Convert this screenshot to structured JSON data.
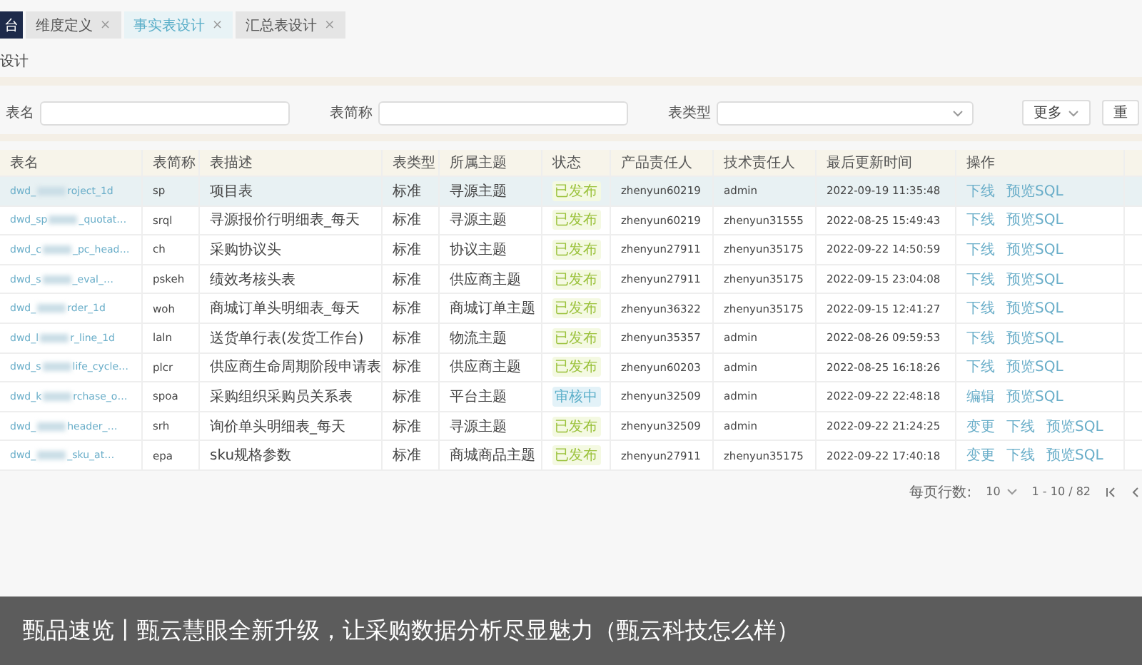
{
  "tabs": [
    {
      "label": "台",
      "selected": false,
      "kind": "home"
    },
    {
      "label": "维度定义",
      "close": "×",
      "selected": false,
      "kind": "page"
    },
    {
      "label": "事实表设计",
      "close": "×",
      "selected": true,
      "kind": "page"
    },
    {
      "label": "汇总表设计",
      "close": "×",
      "selected": false,
      "kind": "page"
    }
  ],
  "page_title": "设计",
  "filters": [
    {
      "label": "表名",
      "kind": "input"
    },
    {
      "label": "表简称",
      "kind": "input"
    },
    {
      "label": "表类型",
      "kind": "select"
    }
  ],
  "buttons": [
    {
      "label": "更多",
      "kind": "dropdown"
    },
    {
      "label": "重",
      "kind": "plain"
    }
  ],
  "table": {
    "columns": [
      "表名",
      "表简称",
      "表描述",
      "表类型",
      "所属主题",
      "状态",
      "产品责任人",
      "技术责任人",
      "最后更新时间",
      "操作"
    ],
    "rows": [
      {
        "name_start": "dwd_",
        "name_end": "roject_1d",
        "short": "sp",
        "desc": "项目表",
        "type": "标准",
        "theme": "寻源主题",
        "status": {
          "label": "已发布",
          "kind": "published"
        },
        "owner": "zhenyun60219",
        "tech": "admin",
        "updated": "2022-09-19 11:35:48",
        "actions": [
          "下线",
          "预览SQL"
        ],
        "selected": true
      },
      {
        "name_start": "dwd_sp",
        "name_end": "_quotat…",
        "short": "srql",
        "desc": "寻源报价行明细表_每天",
        "type": "标准",
        "theme": "寻源主题",
        "status": {
          "label": "已发布",
          "kind": "published"
        },
        "owner": "zhenyun60219",
        "tech": "zhenyun31555",
        "updated": "2022-08-25 15:49:43",
        "actions": [
          "下线",
          "预览SQL"
        ],
        "selected": false
      },
      {
        "name_start": "dwd_c",
        "name_end": "_pc_head…",
        "short": "ch",
        "desc": "采购协议头",
        "type": "标准",
        "theme": "协议主题",
        "status": {
          "label": "已发布",
          "kind": "published"
        },
        "owner": "zhenyun27911",
        "tech": "zhenyun35175",
        "updated": "2022-09-22 14:50:59",
        "actions": [
          "下线",
          "预览SQL"
        ],
        "selected": false
      },
      {
        "name_start": "dwd_s",
        "name_end": "_eval_…",
        "short": "pskeh",
        "desc": "绩效考核头表",
        "type": "标准",
        "theme": "供应商主题",
        "status": {
          "label": "已发布",
          "kind": "published"
        },
        "owner": "zhenyun27911",
        "tech": "zhenyun35175",
        "updated": "2022-09-15 23:04:08",
        "actions": [
          "下线",
          "预览SQL"
        ],
        "selected": false
      },
      {
        "name_start": "dwd_",
        "name_end": "rder_1d",
        "short": "woh",
        "desc": "商城订单头明细表_每天",
        "type": "标准",
        "theme": "商城订单主题",
        "status": {
          "label": "已发布",
          "kind": "published"
        },
        "owner": "zhenyun36322",
        "tech": "zhenyun35175",
        "updated": "2022-09-15 12:41:27",
        "actions": [
          "下线",
          "预览SQL"
        ],
        "selected": false
      },
      {
        "name_start": "dwd_l",
        "name_end": "r_line_1d",
        "short": "laln",
        "desc": "送货单行表(发货工作台)",
        "type": "标准",
        "theme": "物流主题",
        "status": {
          "label": "已发布",
          "kind": "published"
        },
        "owner": "zhenyun35357",
        "tech": "admin",
        "updated": "2022-08-26 09:59:53",
        "actions": [
          "下线",
          "预览SQL"
        ],
        "selected": false
      },
      {
        "name_start": "dwd_s",
        "name_end": "life_cycle…",
        "short": "plcr",
        "desc": "供应商生命周期阶段申请表",
        "type": "标准",
        "theme": "供应商主题",
        "status": {
          "label": "已发布",
          "kind": "published"
        },
        "owner": "zhenyun60203",
        "tech": "admin",
        "updated": "2022-08-25 16:18:26",
        "actions": [
          "下线",
          "预览SQL"
        ],
        "selected": false
      },
      {
        "name_start": "dwd_k",
        "name_end": "rchase_o…",
        "short": "spoa",
        "desc": "采购组织采购员关系表",
        "type": "标准",
        "theme": "平台主题",
        "status": {
          "label": "审核中",
          "kind": "review"
        },
        "owner": "zhenyun32509",
        "tech": "admin",
        "updated": "2022-09-22 22:48:18",
        "actions": [
          "编辑",
          "预览SQL"
        ],
        "selected": false
      },
      {
        "name_start": "dwd_",
        "name_end": "header_…",
        "short": "srh",
        "desc": "询价单头明细表_每天",
        "type": "标准",
        "theme": "寻源主题",
        "status": {
          "label": "已发布",
          "kind": "published"
        },
        "owner": "zhenyun32509",
        "tech": "admin",
        "updated": "2022-09-22 21:24:25",
        "actions": [
          "变更",
          "下线",
          "预览SQL"
        ],
        "selected": false
      },
      {
        "name_start": "dwd_",
        "name_end": "_sku_at…",
        "short": "epa",
        "desc": "sku规格参数",
        "type": "标准",
        "theme": "商城商品主题",
        "status": {
          "label": "已发布",
          "kind": "published"
        },
        "owner": "zhenyun27911",
        "tech": "zhenyun35175",
        "updated": "2022-09-22 17:40:18",
        "actions": [
          "变更",
          "下线",
          "预览SQL"
        ],
        "selected": false
      }
    ]
  },
  "pagination": {
    "rows_label": "每页行数:",
    "page_size": "10",
    "range": "1 - 10 / 82"
  },
  "caption": "甄品速览丨甄云慧眼全新升级，让采购数据分析尽显魅力（甄云科技怎么样）"
}
